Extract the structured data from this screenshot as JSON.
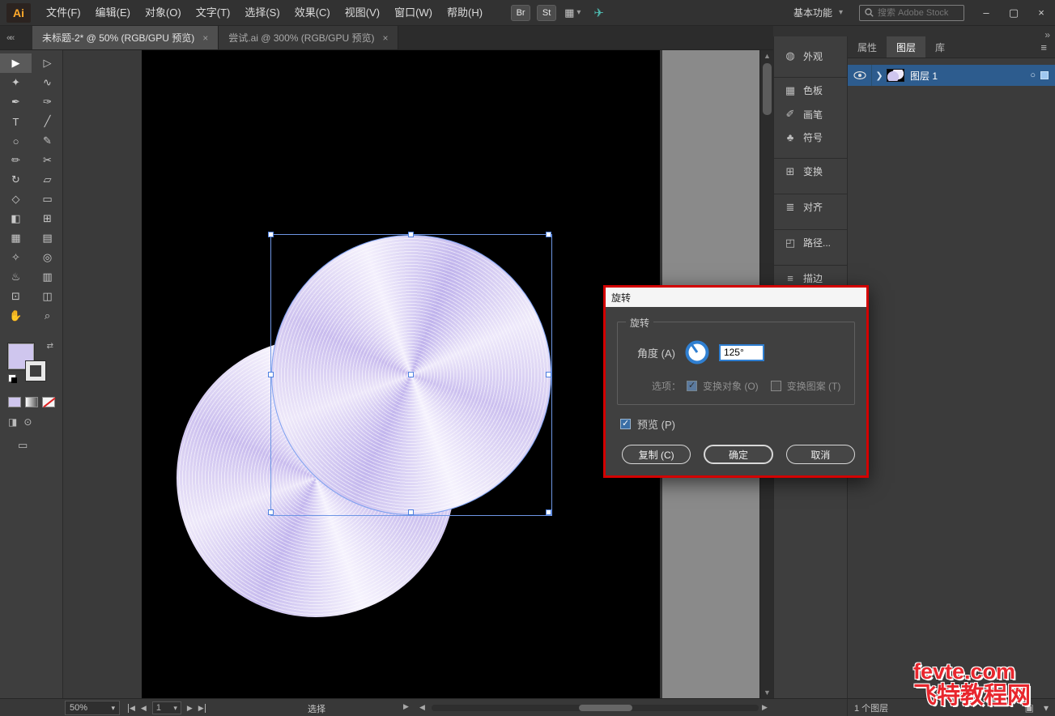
{
  "menubar": {
    "logo": "Ai",
    "items": [
      "文件(F)",
      "编辑(E)",
      "对象(O)",
      "文字(T)",
      "选择(S)",
      "效果(C)",
      "视图(V)",
      "窗口(W)",
      "帮助(H)"
    ],
    "bridge_label": "Br",
    "stock_label": "St",
    "workspace_label": "基本功能",
    "search_placeholder": "搜索 Adobe Stock",
    "minimize_glyph": "–",
    "maximize_glyph": "▢",
    "close_glyph": "×"
  },
  "document_tabs": [
    {
      "label": "未标题-2* @ 50% (RGB/GPU 预览)",
      "close": "×",
      "active": true
    },
    {
      "label": "尝试.ai @ 300% (RGB/GPU 预览)",
      "close": "×",
      "active": false
    }
  ],
  "toolbar": {
    "tools": [
      {
        "name": "selection-tool",
        "glyph": "▶",
        "active": true
      },
      {
        "name": "direct-selection-tool",
        "glyph": "▷"
      },
      {
        "name": "magic-wand-tool",
        "glyph": "✦"
      },
      {
        "name": "lasso-tool",
        "glyph": "∿"
      },
      {
        "name": "pen-tool",
        "glyph": "✒"
      },
      {
        "name": "curvature-tool",
        "glyph": "✑"
      },
      {
        "name": "type-tool",
        "glyph": "T"
      },
      {
        "name": "line-tool",
        "glyph": "╱"
      },
      {
        "name": "ellipse-tool",
        "glyph": "○"
      },
      {
        "name": "paintbrush-tool",
        "glyph": "✎"
      },
      {
        "name": "pencil-tool",
        "glyph": "✏"
      },
      {
        "name": "scissors-tool",
        "glyph": "✂"
      },
      {
        "name": "rotate-tool",
        "glyph": "↻"
      },
      {
        "name": "scale-tool",
        "glyph": "▱"
      },
      {
        "name": "width-tool",
        "glyph": "◇"
      },
      {
        "name": "free-transform-tool",
        "glyph": "▭"
      },
      {
        "name": "shape-builder-tool",
        "glyph": "◧"
      },
      {
        "name": "perspective-grid-tool",
        "glyph": "⊞"
      },
      {
        "name": "mesh-tool",
        "glyph": "▦"
      },
      {
        "name": "gradient-tool",
        "glyph": "▤"
      },
      {
        "name": "eyedropper-tool",
        "glyph": "✧"
      },
      {
        "name": "blend-tool",
        "glyph": "◎"
      },
      {
        "name": "symbol-sprayer-tool",
        "glyph": "♨"
      },
      {
        "name": "graph-tool",
        "glyph": "▥"
      },
      {
        "name": "artboard-tool",
        "glyph": "⊡"
      },
      {
        "name": "slice-tool",
        "glyph": "◫"
      },
      {
        "name": "hand-tool",
        "glyph": "✋"
      },
      {
        "name": "zoom-tool",
        "glyph": "⌕"
      }
    ]
  },
  "right_rail": {
    "items": [
      {
        "name": "panel-appearance",
        "glyph": "◍",
        "label": "外观"
      },
      {
        "name": "panel-swatches",
        "glyph": "▦",
        "label": "色板",
        "gap": true
      },
      {
        "name": "panel-brushes",
        "glyph": "✐",
        "label": "画笔"
      },
      {
        "name": "panel-symbols",
        "glyph": "♣",
        "label": "符号"
      },
      {
        "name": "panel-transform",
        "glyph": "⊞",
        "label": "变换",
        "gap": true
      },
      {
        "name": "panel-align",
        "glyph": "≣",
        "label": "对齐",
        "gap": true
      },
      {
        "name": "panel-pathfinder",
        "glyph": "◰",
        "label": "路径...",
        "gap": true
      },
      {
        "name": "panel-stroke",
        "glyph": "≡",
        "label": "描边",
        "gap": true
      }
    ]
  },
  "panel": {
    "tabs": [
      {
        "label": "属性",
        "active": false
      },
      {
        "label": "图层",
        "active": true
      },
      {
        "label": "库",
        "active": false
      }
    ],
    "layer_name": "图层 1",
    "footer_count": "1 个图层"
  },
  "rotate_dialog": {
    "title": "旋转",
    "section_label": "旋转",
    "angle_label": "角度 (A)",
    "angle_value": "125°",
    "options_label": "选项：",
    "transform_objects_label": "变换对象 (O)",
    "transform_patterns_label": "变换图案 (T)",
    "preview_label": "预览 (P)",
    "copy_button": "复制 (C)",
    "ok_button": "确定",
    "cancel_button": "取消",
    "highlight_color": "#d30000"
  },
  "statusbar": {
    "zoom": "50%",
    "page": "1",
    "status_label": "选择"
  },
  "watermark": {
    "line1": "fevte.com",
    "line2": "飞特教程网"
  },
  "canvas": {
    "artboard_color": "#000000",
    "disc_color": "#cfc6ee",
    "selection_blue": "#6e96e4"
  }
}
